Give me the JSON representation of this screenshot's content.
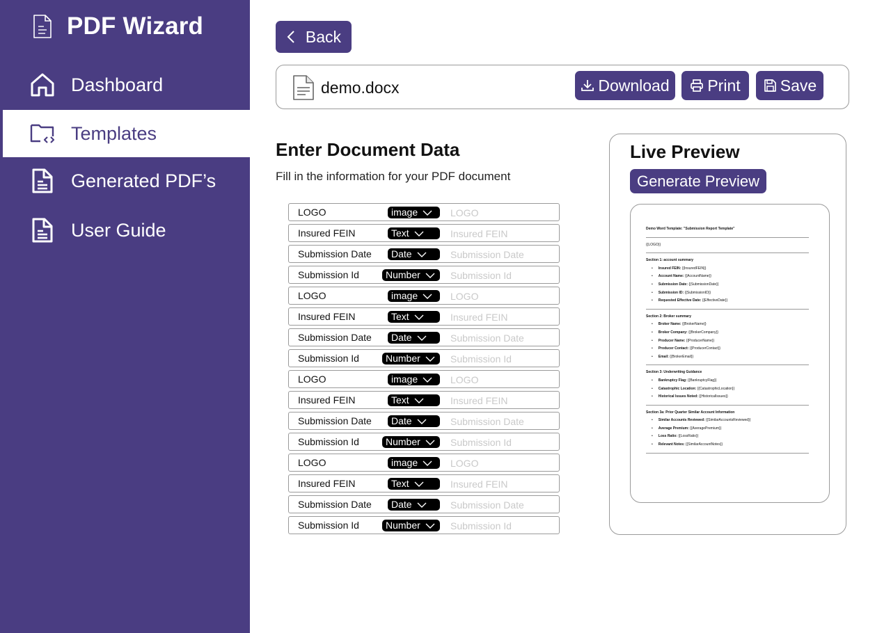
{
  "app": {
    "title": "PDF Wizard",
    "icon": "document-icon"
  },
  "sidebar": {
    "items": [
      {
        "label": "Dashboard",
        "icon": "home-icon",
        "active": false
      },
      {
        "label": "Templates",
        "icon": "folder-code-icon",
        "active": true
      },
      {
        "label": "Generated PDF’s",
        "icon": "document-icon",
        "active": false
      },
      {
        "label": "User Guide",
        "icon": "document-icon",
        "active": false
      }
    ]
  },
  "toolbar": {
    "back_label": "Back",
    "file_name": "demo.docx",
    "download_label": "Download",
    "print_label": "Print",
    "save_label": "Save"
  },
  "form": {
    "title": "Enter Document Data",
    "subtitle": "Fill in the information for your PDF document",
    "fields": [
      {
        "label": "LOGO",
        "type": "image",
        "placeholder": "LOGO"
      },
      {
        "label": "Insured FEIN",
        "type": "Text",
        "placeholder": "Insured FEIN"
      },
      {
        "label": "Submission Date",
        "type": "Date",
        "placeholder": "Submission Date"
      },
      {
        "label": "Submission Id",
        "type": "Number",
        "placeholder": "Submission Id"
      },
      {
        "label": "LOGO",
        "type": "image",
        "placeholder": "LOGO"
      },
      {
        "label": "Insured FEIN",
        "type": "Text",
        "placeholder": "Insured FEIN"
      },
      {
        "label": "Submission Date",
        "type": "Date",
        "placeholder": "Submission Date"
      },
      {
        "label": "Submission Id",
        "type": "Number",
        "placeholder": "Submission Id"
      },
      {
        "label": "LOGO",
        "type": "image",
        "placeholder": "LOGO"
      },
      {
        "label": "Insured FEIN",
        "type": "Text",
        "placeholder": "Insured FEIN"
      },
      {
        "label": "Submission Date",
        "type": "Date",
        "placeholder": "Submission Date"
      },
      {
        "label": "Submission Id",
        "type": "Number",
        "placeholder": "Submission Id"
      },
      {
        "label": "LOGO",
        "type": "image",
        "placeholder": "LOGO"
      },
      {
        "label": "Insured FEIN",
        "type": "Text",
        "placeholder": "Insured FEIN"
      },
      {
        "label": "Submission Date",
        "type": "Date",
        "placeholder": "Submission Date"
      },
      {
        "label": "Submission Id",
        "type": "Number",
        "placeholder": "Submission Id"
      }
    ]
  },
  "preview": {
    "title": "Live Preview",
    "generate_label": "Generate Preview",
    "document": {
      "heading": "Demo Word Template: \"Submission Report Template\"",
      "logo": "{{LOGO}}",
      "sections": [
        {
          "title": "Section 1: account summary",
          "items": [
            {
              "key": "Insured FEIN:",
              "value": "{{InsuredFEIN}}"
            },
            {
              "key": "Account Name:",
              "value": "{{AccountName}}"
            },
            {
              "key": "Submission Date:",
              "value": "{{SubmissionDate}}"
            },
            {
              "key": "Submission ID:",
              "value": "{{SubmissionID}}"
            },
            {
              "key": "Requested Effective Date:",
              "value": "{{EffectiveDate}}"
            }
          ]
        },
        {
          "title": "Section 2: Broker summary",
          "items": [
            {
              "key": "Broker Name:",
              "value": "{{BrokerName}}"
            },
            {
              "key": "Broker Company:",
              "value": "{{BrokerCompany}}"
            },
            {
              "key": "Producer Name:",
              "value": "{{ProducerName}}"
            },
            {
              "key": "Producer Contact:",
              "value": "{{ProducerContact}}"
            },
            {
              "key": "Email:",
              "value": "{{BrokerEmail}}"
            }
          ]
        },
        {
          "title": "Section 3: Underwriting Guidance",
          "items": [
            {
              "key": "Bankruptcy Flag:",
              "value": "{{BankruptcyFlag}}"
            },
            {
              "key": "Catastrophic Location:",
              "value": "{{CatastrophicLocation}}"
            },
            {
              "key": "Historical Issues Noted:",
              "value": "{{HistoricalIssues}}"
            }
          ]
        },
        {
          "title": "Section 3a: Prior Quarter Similar Account Information",
          "items": [
            {
              "key": "Similar Accounts Reviewed:",
              "value": "{{SimilarAccountsReviewed}}"
            },
            {
              "key": "Average Premium:",
              "value": "{{AveragePremium}}"
            },
            {
              "key": "Loss Ratio:",
              "value": "{{LossRatio}}"
            },
            {
              "key": "Relevant Notes:",
              "value": "{{SimilarAccountNotes}}"
            }
          ]
        }
      ]
    }
  },
  "colors": {
    "brand": "#4a3d82",
    "sidebar_text": "#ffffff",
    "type_badge": "#000000",
    "border": "#9a9a9a"
  }
}
